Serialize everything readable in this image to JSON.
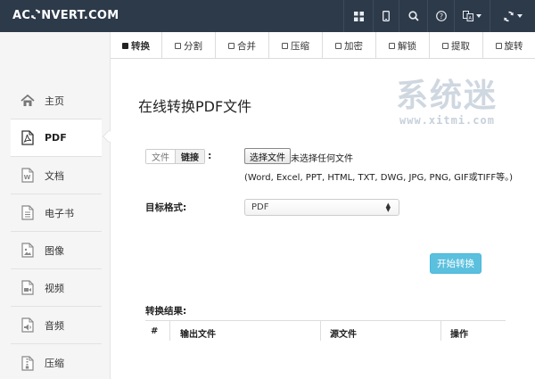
{
  "header": {
    "logo_left": "AC",
    "logo_right": "NVERT.COM",
    "icons": [
      "grid-icon",
      "mobile-icon",
      "search-icon",
      "help-icon",
      "language-icon",
      "refresh-icon"
    ]
  },
  "tabs": [
    {
      "label": "转换",
      "active": true
    },
    {
      "label": "分割"
    },
    {
      "label": "合并"
    },
    {
      "label": "压缩"
    },
    {
      "label": "加密"
    },
    {
      "label": "解锁"
    },
    {
      "label": "提取"
    },
    {
      "label": "旋转"
    }
  ],
  "sidebar": {
    "items": [
      {
        "label": "主页",
        "icon": "home-icon"
      },
      {
        "label": "PDF",
        "icon": "pdf-icon",
        "active": true
      },
      {
        "label": "文档",
        "icon": "word-doc-icon"
      },
      {
        "label": "电子书",
        "icon": "ebook-icon"
      },
      {
        "label": "图像",
        "icon": "image-icon"
      },
      {
        "label": "视频",
        "icon": "video-icon"
      },
      {
        "label": "音频",
        "icon": "audio-icon"
      },
      {
        "label": "压缩",
        "icon": "archive-icon"
      }
    ]
  },
  "main": {
    "title": "在线转换PDF文件",
    "source_toggle": {
      "file": "文件",
      "link": "链接",
      "colon": ":"
    },
    "file_button": "选择文件",
    "file_none": "未选择任何文件",
    "formats_hint": "(Word, Excel, PPT, HTML, TXT, DWG, JPG, PNG, GIF或TIFF等。)",
    "target_label": "目标格式:",
    "target_value": "PDF",
    "start_button": "开始转换",
    "result_label": "转换结果:",
    "result_columns": [
      "#",
      "输出文件",
      "源文件",
      "操作"
    ]
  },
  "watermark": {
    "big": "系统迷",
    "small": "www.xitmi.com"
  },
  "colors": {
    "topbar": "#2d3a4a",
    "start_button": "#5bc0de",
    "sidebar": "#f5f5f5"
  }
}
